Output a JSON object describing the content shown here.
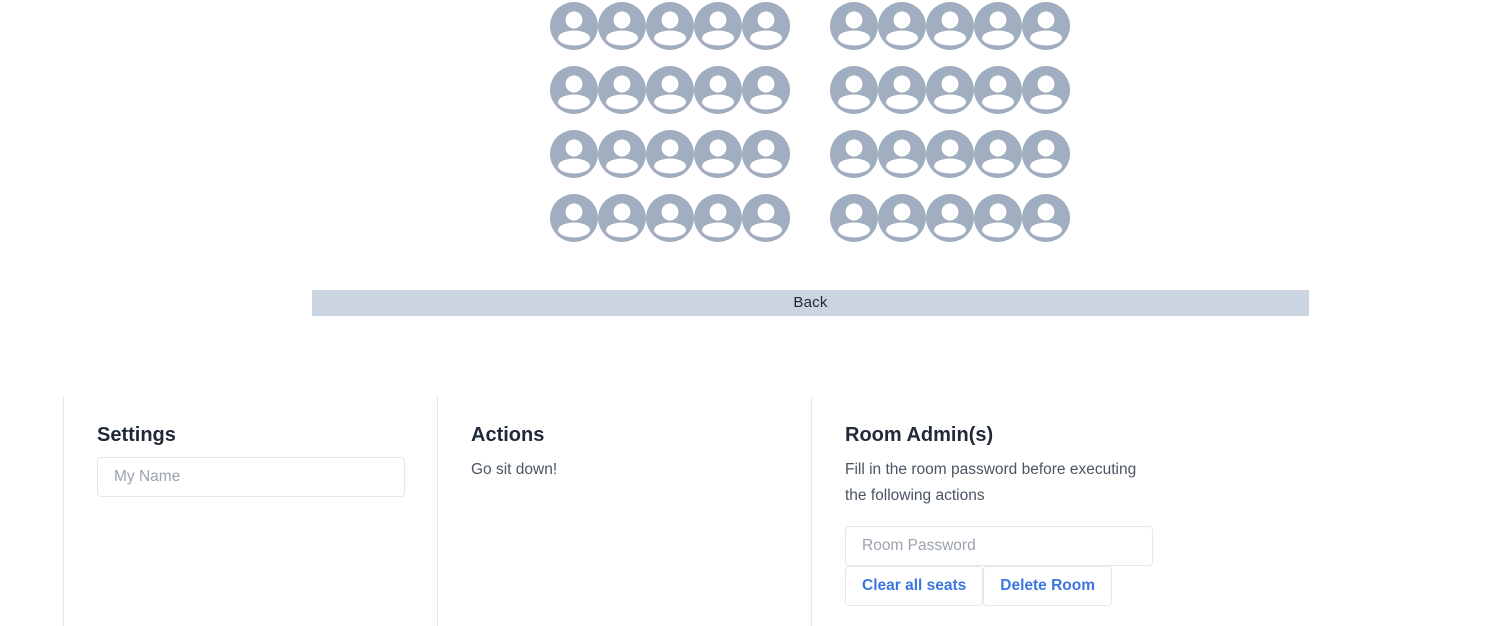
{
  "seating": {
    "rows": 4,
    "seats_per_block": 5,
    "blocks": 2,
    "seat_icon": "user-avatar-icon",
    "seat_color": "#a0aec0"
  },
  "back_label": "Back",
  "settings": {
    "heading": "Settings",
    "name_placeholder": "My Name"
  },
  "actions": {
    "heading": "Actions",
    "status_text": "Go sit down!"
  },
  "admin": {
    "heading": "Room Admin(s)",
    "description": "Fill in the room password before executing the following actions",
    "password_placeholder": "Room Password",
    "clear_label": "Clear all seats",
    "delete_label": "Delete Room"
  },
  "colors": {
    "accent": "#3b76e0",
    "back_bar": "#cbd5e1",
    "seat": "#a0aec0"
  }
}
